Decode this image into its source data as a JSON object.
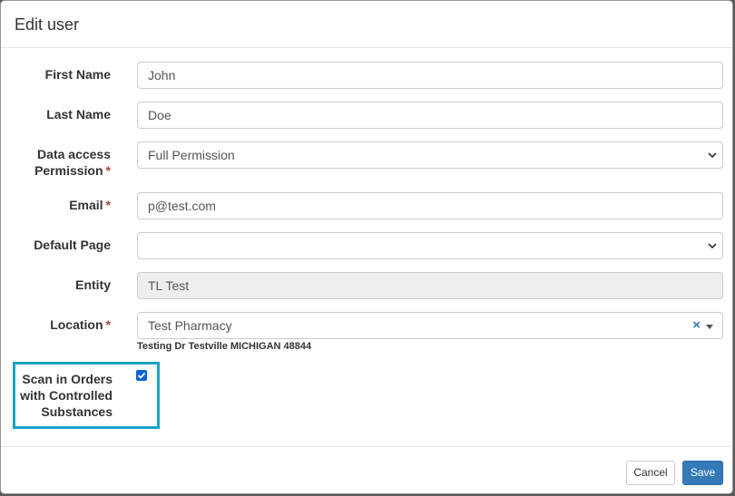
{
  "dialog": {
    "title": "Edit user"
  },
  "form": {
    "first_name": {
      "label": "First Name",
      "value": "John"
    },
    "last_name": {
      "label": "Last Name",
      "value": "Doe"
    },
    "data_access": {
      "label_line1": "Data access",
      "label_line2": "Permission",
      "required_mark": "*",
      "value": "Full Permission"
    },
    "email": {
      "label": "Email",
      "required_mark": "*",
      "value": "p@test.com"
    },
    "default_page": {
      "label": "Default Page",
      "value": ""
    },
    "entity": {
      "label": "Entity",
      "value": "TL Test"
    },
    "location": {
      "label": "Location",
      "required_mark": "*",
      "value": "Test Pharmacy",
      "clear_icon": "×",
      "address": "Testing Dr Testville MICHIGAN 48844"
    },
    "scan_controlled": {
      "label_line1": "Scan in Orders",
      "label_line2": "with Controlled",
      "label_line3": "Substances",
      "checked": true
    }
  },
  "footer": {
    "cancel_label": "Cancel",
    "save_label": "Save"
  },
  "colors": {
    "primary": "#337ab7",
    "highlight": "#1aa3c7",
    "required": "#a94442"
  }
}
